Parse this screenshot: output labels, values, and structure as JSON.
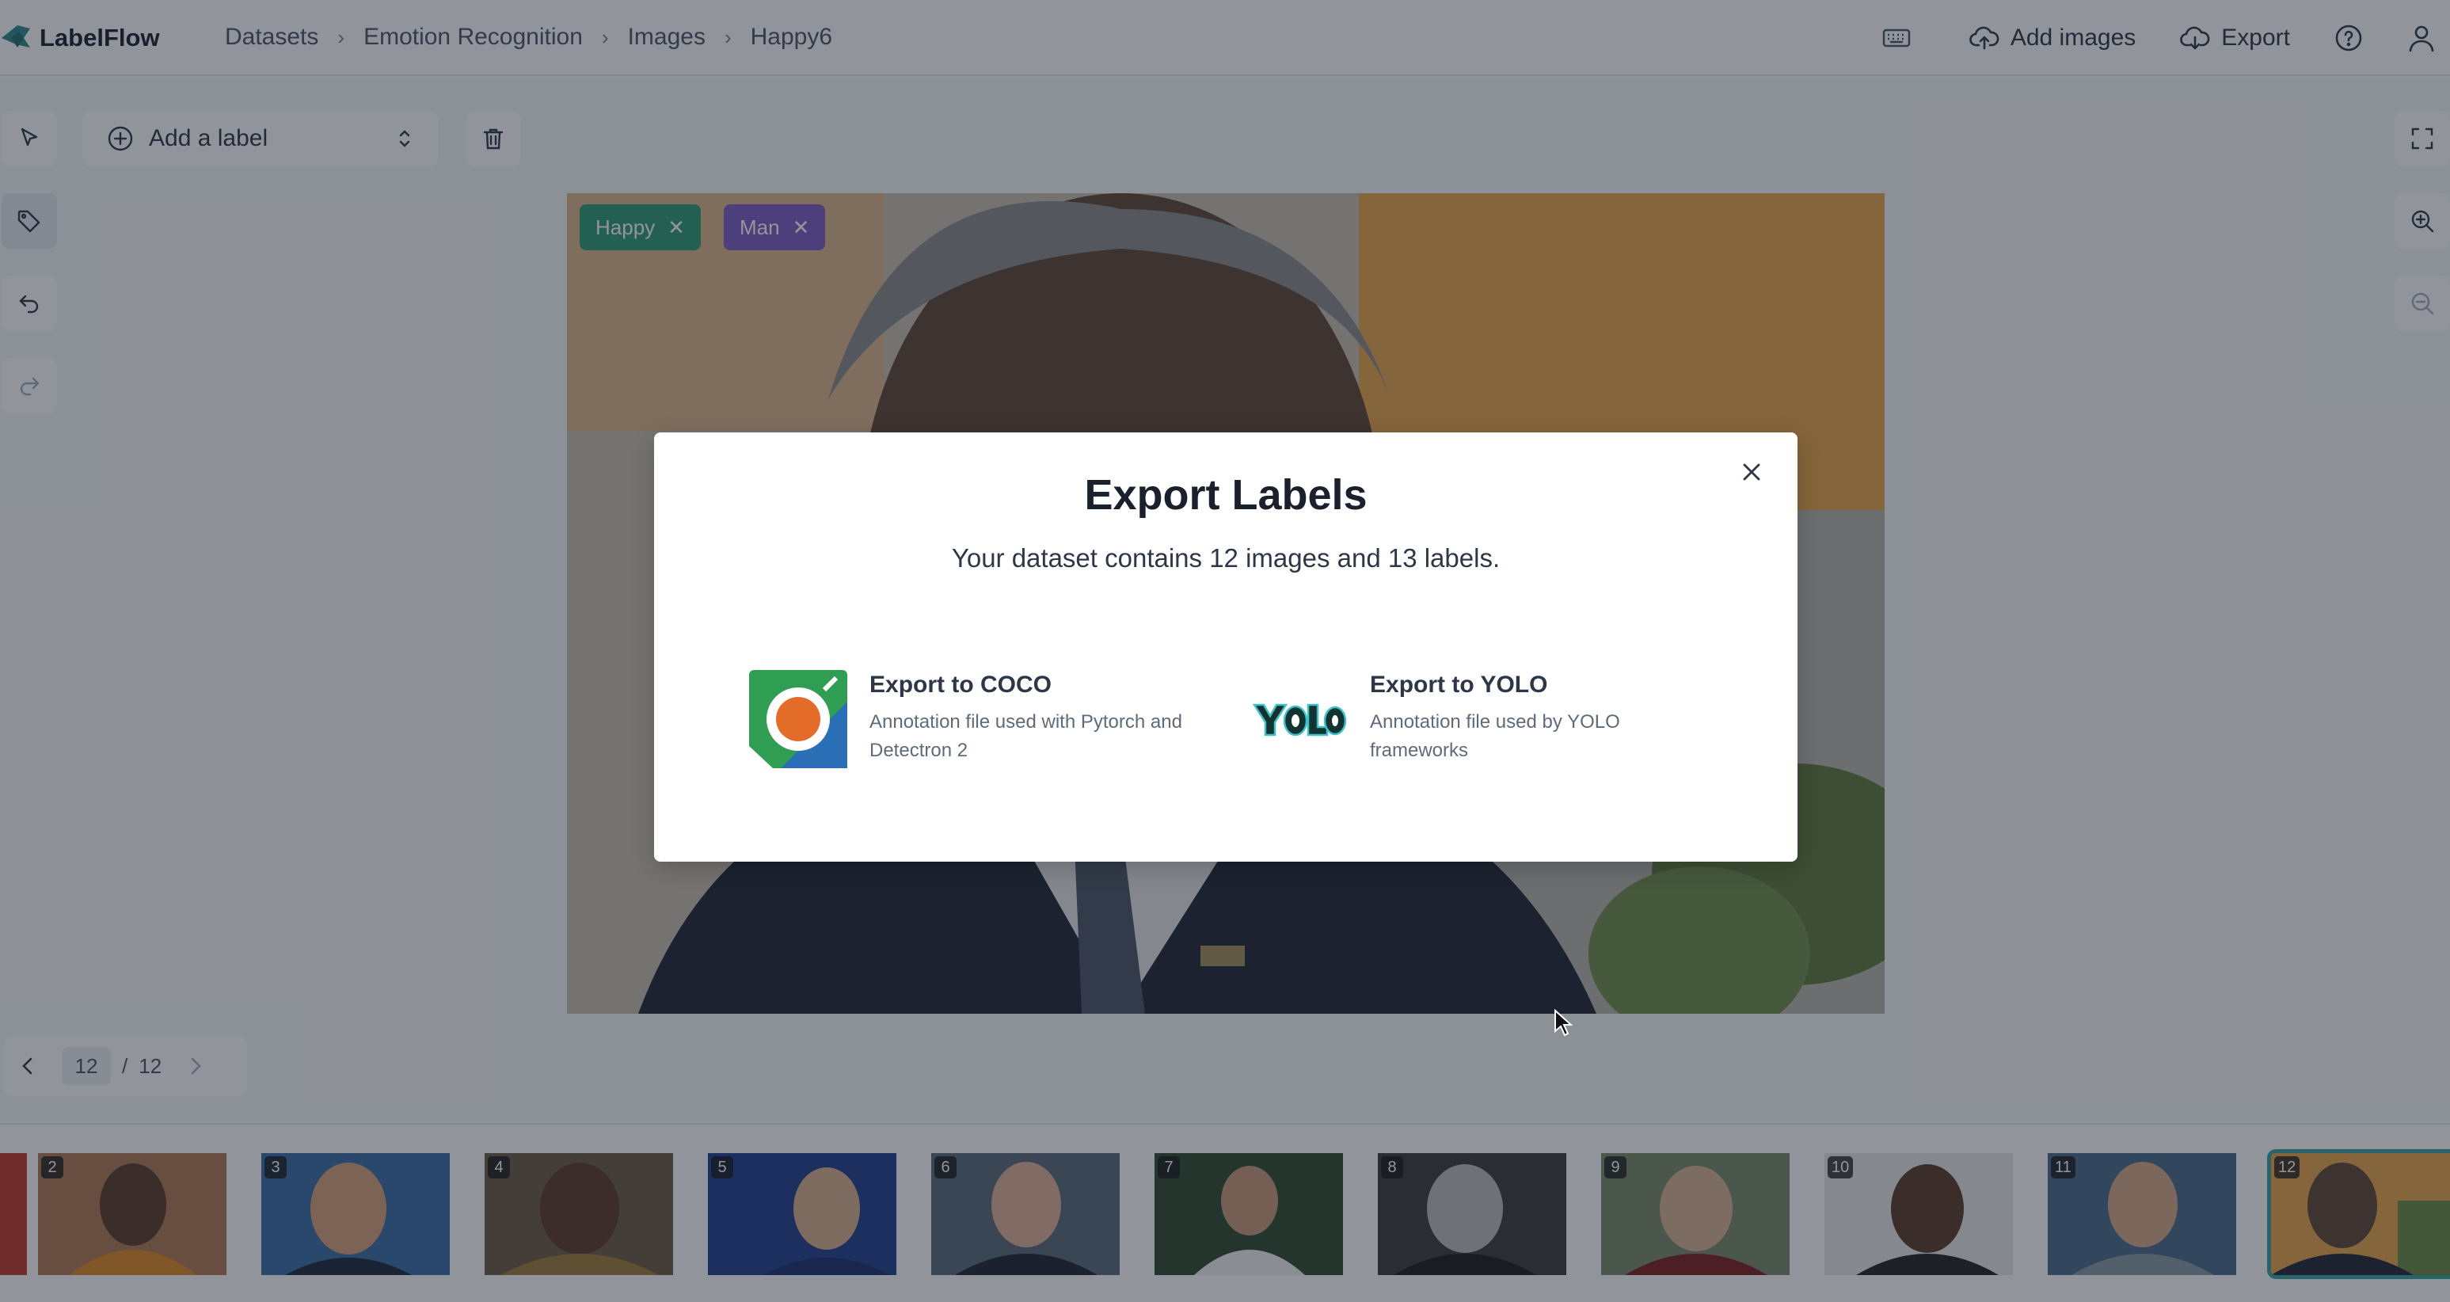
{
  "header": {
    "app_name": "LabelFlow",
    "breadcrumb": [
      "Datasets",
      "Emotion Recognition",
      "Images",
      "Happy6"
    ],
    "add_images_label": "Add images",
    "export_label": "Export"
  },
  "toolbar": {
    "add_label_text": "Add a label"
  },
  "canvas": {
    "tags": [
      {
        "label": "Happy",
        "color": "#2f9c73"
      },
      {
        "label": "Man",
        "color": "#7b5cc4"
      }
    ]
  },
  "pager": {
    "current": "12",
    "separator": "/",
    "total": "12"
  },
  "gallery": {
    "thumbnails": [
      {
        "number": "2",
        "selected": false
      },
      {
        "number": "3",
        "selected": false
      },
      {
        "number": "4",
        "selected": false
      },
      {
        "number": "5",
        "selected": false
      },
      {
        "number": "6",
        "selected": false
      },
      {
        "number": "7",
        "selected": false
      },
      {
        "number": "8",
        "selected": false
      },
      {
        "number": "9",
        "selected": false
      },
      {
        "number": "10",
        "selected": false
      },
      {
        "number": "11",
        "selected": false
      },
      {
        "number": "12",
        "selected": true
      }
    ]
  },
  "modal": {
    "title": "Export Labels",
    "subtitle": "Your dataset contains 12 images and 13 labels.",
    "options": [
      {
        "name": "Export to COCO",
        "description": "Annotation file used with Pytorch and Detectron 2",
        "icon": "coco-logo"
      },
      {
        "name": "Export to YOLO",
        "description": "Annotation file used by YOLO frameworks",
        "icon": "yolo-logo"
      }
    ]
  },
  "colors": {
    "accent": "#38a3a5",
    "overlay": "rgba(26,32,44,0.48)"
  }
}
